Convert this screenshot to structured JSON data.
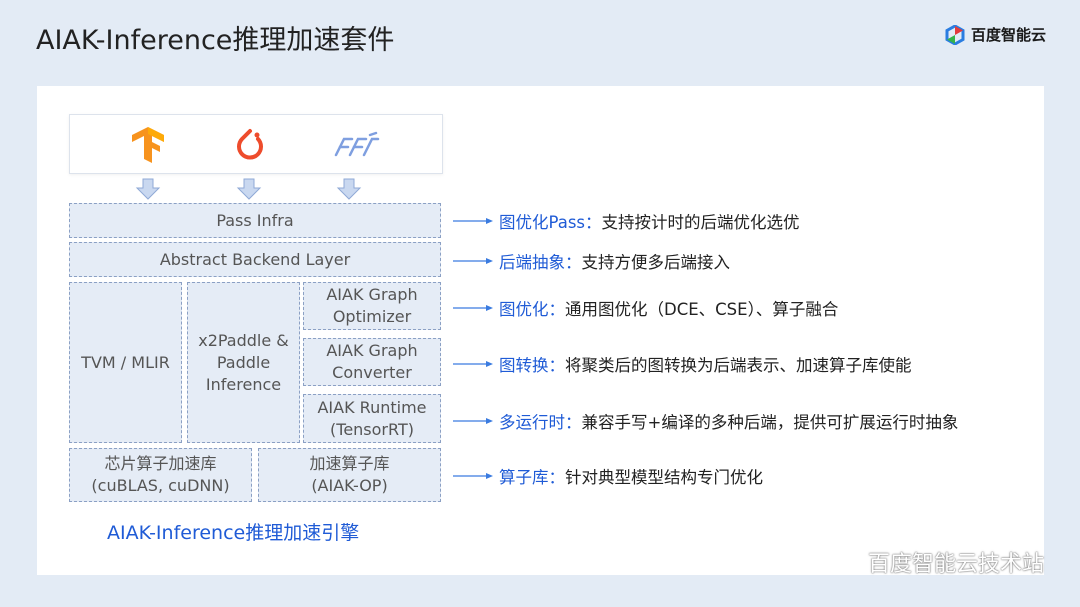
{
  "header": {
    "title": "AIAK-Inference推理加速套件",
    "brand": "百度智能云"
  },
  "frameworks": [
    {
      "icon": "tensorflow-icon"
    },
    {
      "icon": "pytorch-icon"
    },
    {
      "icon": "paddle-icon"
    }
  ],
  "layers": {
    "pass_infra": "Pass Infra",
    "abstract_backend": "Abstract Backend Layer",
    "tvm_mlir": "TVM / MLIR",
    "x2paddle": "x2Paddle & Paddle Inference",
    "graph_optimizer": "AIAK Graph Optimizer",
    "graph_converter": "AIAK Graph Converter",
    "runtime": "AIAK Runtime (TensorRT)",
    "chip_lib": "芯片算子加速库 (cuBLAS, cuDNN)",
    "accel_lib": "加速算子库 (AIAK-OP)"
  },
  "annotations": [
    {
      "key": "图优化Pass：",
      "text": "支持按计时的后端优化选优"
    },
    {
      "key": "后端抽象：",
      "text": "支持方便多后端接入"
    },
    {
      "key": "图优化：",
      "text": "通用图优化（DCE、CSE）、算子融合"
    },
    {
      "key": "图转换：",
      "text": "将聚类后的图转换为后端表示、加速算子库使能"
    },
    {
      "key": "多运行时：",
      "text": "兼容手写+编译的多种后端，提供可扩展运行时抽象"
    },
    {
      "key": "算子库：",
      "text": "针对典型模型结构专门优化"
    }
  ],
  "footer": {
    "engine_title": "AIAK-Inference推理加速引擎",
    "watermark": "百度智能云技术站"
  },
  "colors": {
    "accent": "#1f5bd6",
    "box_fill": "#e5ecf6",
    "box_border": "#8ba0c4",
    "background": "#e3ebf5"
  }
}
